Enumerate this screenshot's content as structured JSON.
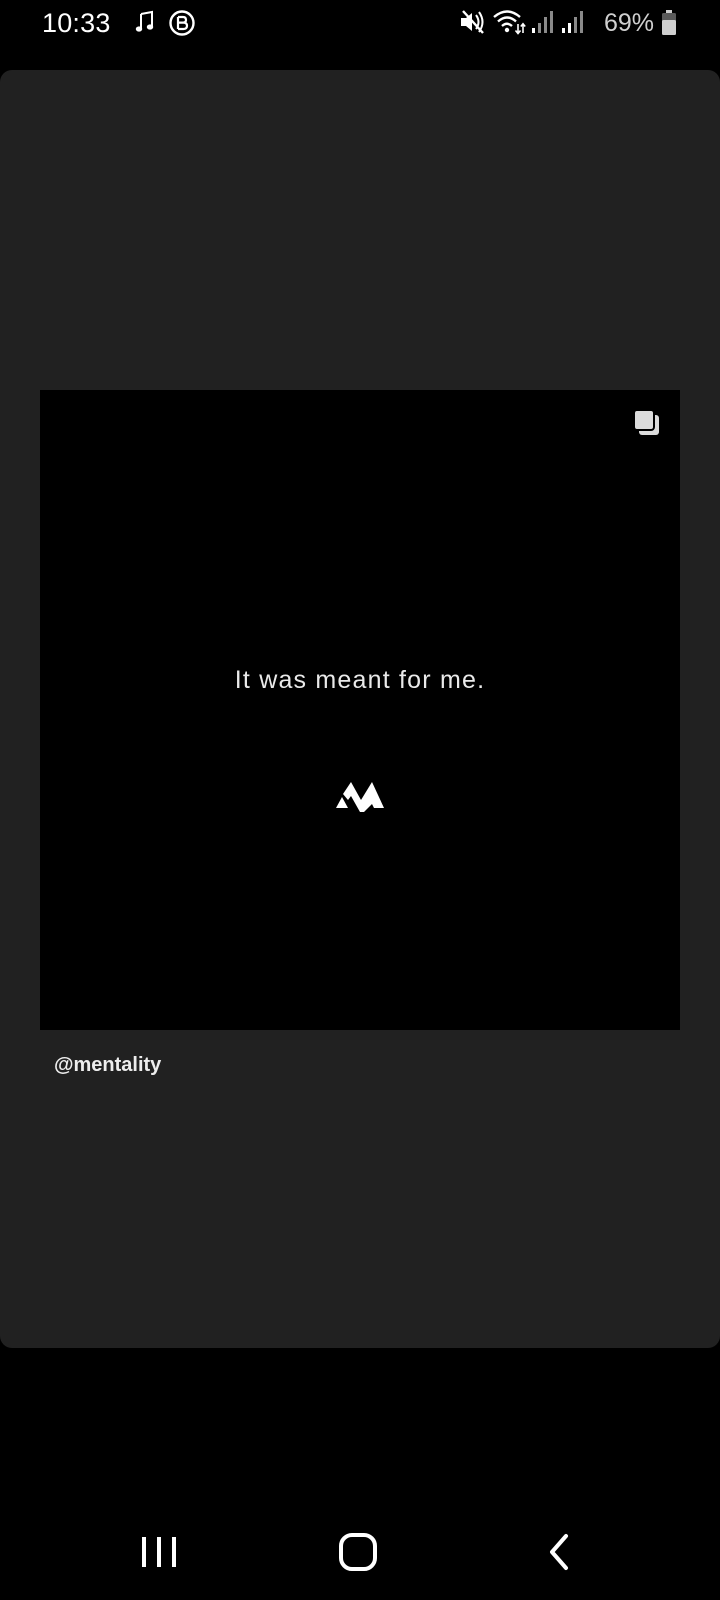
{
  "status_bar": {
    "time": "10:33",
    "battery_percent": "69%",
    "icons": [
      "music-note-icon",
      "b-circle-icon",
      "mute-icon",
      "wifi-icon",
      "signal-icon",
      "signal-icon",
      "battery-icon"
    ]
  },
  "post": {
    "quote": "It was meant for me.",
    "handle": "@mentality",
    "carousel_indicator_icon": "carousel-icon",
    "logo_icon": "mentality-logo"
  },
  "nav_bar": {
    "buttons": [
      "recents-icon",
      "home-icon",
      "back-icon"
    ]
  },
  "colors": {
    "background": "#000000",
    "card": "#212121",
    "post_image": "#000000",
    "text": "#ffffff"
  }
}
